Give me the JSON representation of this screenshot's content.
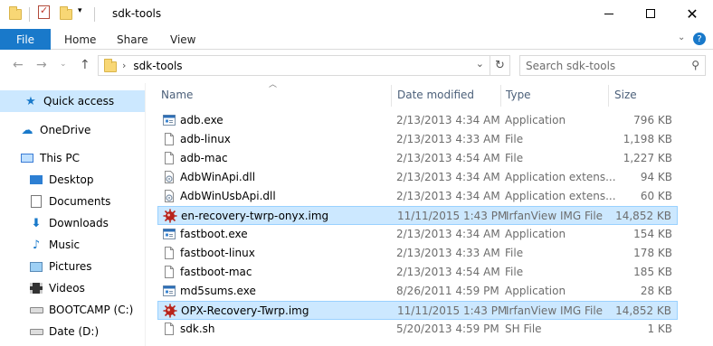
{
  "window": {
    "title": "sdk-tools"
  },
  "ribbon": {
    "file": "File",
    "tabs": [
      "Home",
      "Share",
      "View"
    ]
  },
  "address": {
    "path": "sdk-tools",
    "search_placeholder": "Search sdk-tools"
  },
  "nav": [
    {
      "label": "Quick access",
      "icon": "star-icon",
      "selected": true
    },
    {
      "label": "OneDrive",
      "icon": "cloud-icon"
    },
    {
      "label": "This PC",
      "icon": "computer-icon"
    },
    {
      "label": "Desktop",
      "icon": "desktop-icon"
    },
    {
      "label": "Documents",
      "icon": "documents-icon"
    },
    {
      "label": "Downloads",
      "icon": "download-icon"
    },
    {
      "label": "Music",
      "icon": "music-icon"
    },
    {
      "label": "Pictures",
      "icon": "pictures-icon"
    },
    {
      "label": "Videos",
      "icon": "videos-icon"
    },
    {
      "label": "BOOTCAMP (C:)",
      "icon": "drive-icon"
    },
    {
      "label": "Date (D:)",
      "icon": "drive-icon"
    }
  ],
  "columns": {
    "name": "Name",
    "date": "Date modified",
    "type": "Type",
    "size": "Size"
  },
  "files": [
    {
      "name": "adb.exe",
      "date": "2/13/2013 4:34 AM",
      "type": "Application",
      "size": "796 KB",
      "icon": "exe"
    },
    {
      "name": "adb-linux",
      "date": "2/13/2013 4:33 AM",
      "type": "File",
      "size": "1,198 KB",
      "icon": "file"
    },
    {
      "name": "adb-mac",
      "date": "2/13/2013 4:54 AM",
      "type": "File",
      "size": "1,227 KB",
      "icon": "file"
    },
    {
      "name": "AdbWinApi.dll",
      "date": "2/13/2013 4:34 AM",
      "type": "Application extens...",
      "size": "94 KB",
      "icon": "dll"
    },
    {
      "name": "AdbWinUsbApi.dll",
      "date": "2/13/2013 4:34 AM",
      "type": "Application extens...",
      "size": "60 KB",
      "icon": "dll"
    },
    {
      "name": "en-recovery-twrp-onyx.img",
      "date": "11/11/2015 1:43 PM",
      "type": "IrfanView IMG File",
      "size": "14,852 KB",
      "icon": "img",
      "selected": true
    },
    {
      "name": "fastboot.exe",
      "date": "2/13/2013 4:34 AM",
      "type": "Application",
      "size": "154 KB",
      "icon": "exe"
    },
    {
      "name": "fastboot-linux",
      "date": "2/13/2013 4:33 AM",
      "type": "File",
      "size": "178 KB",
      "icon": "file"
    },
    {
      "name": "fastboot-mac",
      "date": "2/13/2013 4:54 AM",
      "type": "File",
      "size": "185 KB",
      "icon": "file"
    },
    {
      "name": "md5sums.exe",
      "date": "8/26/2011 4:59 PM",
      "type": "Application",
      "size": "28 KB",
      "icon": "exe"
    },
    {
      "name": "OPX-Recovery-Twrp.img",
      "date": "11/11/2015 1:43 PM",
      "type": "IrfanView IMG File",
      "size": "14,852 KB",
      "icon": "img",
      "selected": true
    },
    {
      "name": "sdk.sh",
      "date": "5/20/2013 4:59 PM",
      "type": "SH File",
      "size": "1 KB",
      "icon": "file"
    }
  ]
}
